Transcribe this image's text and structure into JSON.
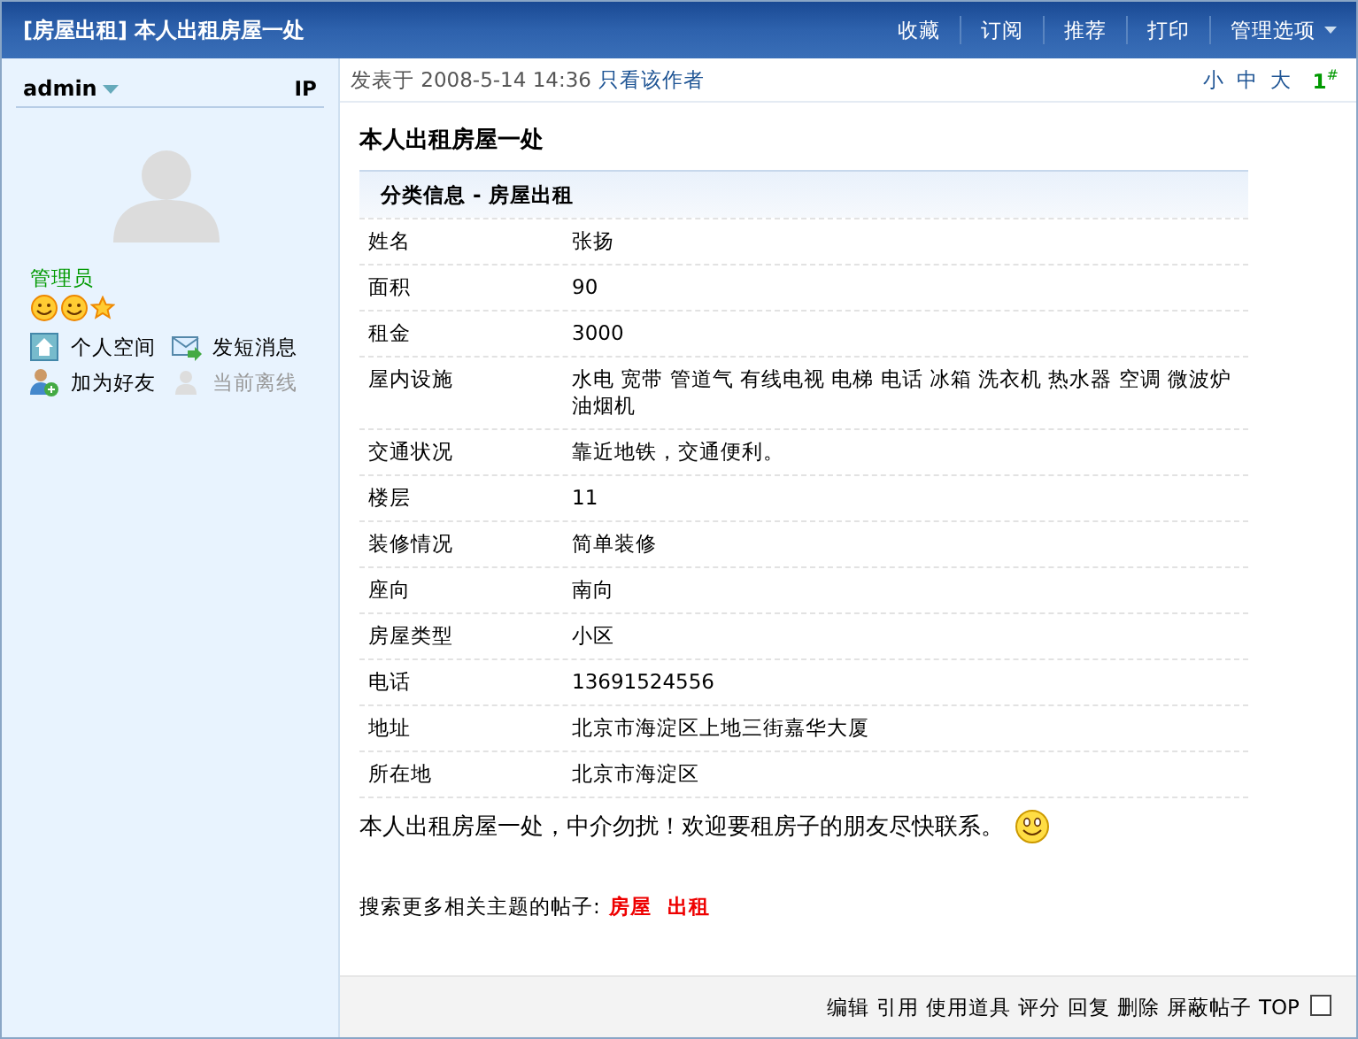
{
  "header": {
    "title": "[房屋出租] 本人出租房屋一处",
    "menu": [
      {
        "label": "收藏",
        "dropdown": false
      },
      {
        "label": "订阅",
        "dropdown": false
      },
      {
        "label": "推荐",
        "dropdown": false
      },
      {
        "label": "打印",
        "dropdown": false
      },
      {
        "label": "管理选项",
        "dropdown": true
      }
    ]
  },
  "sidebar": {
    "username": "admin",
    "ip_label": "IP",
    "role": "管理员",
    "actions": [
      {
        "kind": "home",
        "label": "个人空间",
        "disabled": false
      },
      {
        "kind": "message",
        "label": "发短消息",
        "disabled": false
      },
      {
        "kind": "add-friend",
        "label": "加为好友",
        "disabled": false
      },
      {
        "kind": "offline",
        "label": "当前离线",
        "disabled": true
      }
    ]
  },
  "post": {
    "posted": "发表于 2008-5-14 14:36",
    "author_only": "只看该作者",
    "font_sizes": [
      "小",
      "中",
      "大"
    ],
    "floor": "1$^{#}$",
    "subject": "本人出租房屋一处",
    "table": {
      "title": "分类信息 - 房屋出租",
      "rows": [
        {
          "label": "姓名",
          "value": "张扬"
        },
        {
          "label": "面积",
          "value": "90"
        },
        {
          "label": "租金",
          "value": "3000"
        },
        {
          "label": "屋内设施",
          "value": "水电 宽带 管道气 有线电视 电梯 电话 冰箱 洗衣机 热水器 空调 微波炉油烟机"
        },
        {
          "label": "交通状况",
          "value": "靠近地铁，交通便利。"
        },
        {
          "label": "楼层",
          "value": "11"
        },
        {
          "label": "装修情况",
          "value": "简单装修"
        },
        {
          "label": "座向",
          "value": "南向"
        },
        {
          "label": "房屋类型",
          "value": "小区"
        },
        {
          "label": "电话",
          "value": "13691524556"
        },
        {
          "label": "地址",
          "value": "北京市海淀区上地三街嘉华大厦"
        },
        {
          "label": "所在地",
          "value": "北京市海淀区"
        }
      ]
    },
    "message": "本人出租房屋一处，中介勿扰！欢迎要租房子的朋友尽快联系。",
    "tags_label": "搜索更多相关主题的帖子:",
    "tags": [
      "房屋",
      "出租"
    ]
  },
  "footer": {
    "actions": [
      "编辑",
      "引用",
      "使用道具",
      "评分",
      "回复",
      "删除",
      "屏蔽帖子",
      "TOP"
    ],
    "checked": false
  }
}
